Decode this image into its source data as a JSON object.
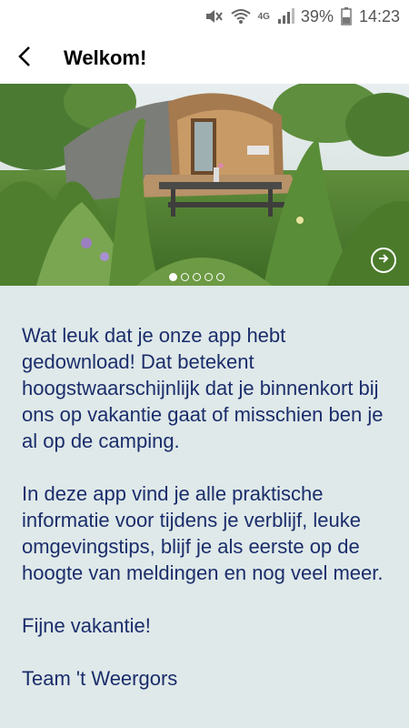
{
  "status_bar": {
    "battery_percent": "39%",
    "time": "14:23",
    "network": "4G",
    "icons": [
      "mute-icon",
      "wifi-icon",
      "signal-icon",
      "battery-icon"
    ]
  },
  "app_bar": {
    "title": "Welkom!",
    "back_icon": "back-arrow-icon"
  },
  "carousel": {
    "slide_count": 5,
    "active_index": 0,
    "next_icon": "arrow-right-circle-icon"
  },
  "content": {
    "paragraph_1": "Wat leuk dat je onze app hebt gedownload! Dat betekent hoogstwaarschijnlijk dat je binnenkort bij ons op vakantie gaat of misschien ben je al op de camping.",
    "paragraph_2": "In deze app vind je alle praktische informatie voor tijdens je verblijf, leuke omgevingstips, blijf je als eerste op de hoogte van meldingen en nog veel meer.",
    "paragraph_3": "Fijne vakantie!",
    "paragraph_4": "Team 't Weergors"
  },
  "colors": {
    "text": "#1b2d6b",
    "content_bg": "#dfe9e9",
    "bar_bg": "#ffffff"
  }
}
